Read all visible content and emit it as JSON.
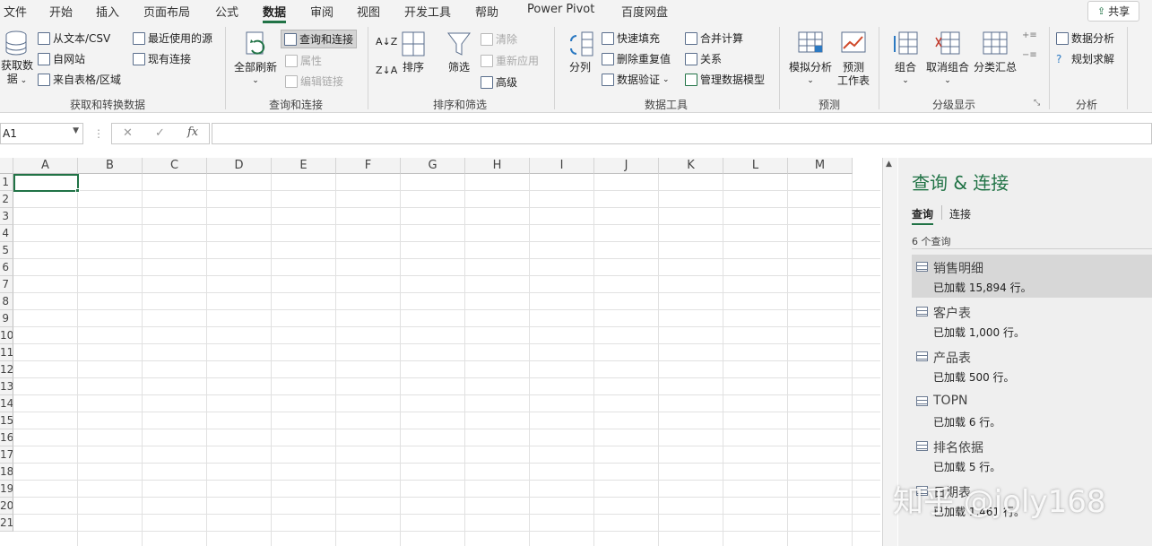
{
  "tabs": [
    {
      "label": "文件"
    },
    {
      "label": "开始"
    },
    {
      "label": "插入"
    },
    {
      "label": "页面布局"
    },
    {
      "label": "公式"
    },
    {
      "label": "数据"
    },
    {
      "label": "审阅"
    },
    {
      "label": "视图"
    },
    {
      "label": "开发工具"
    },
    {
      "label": "帮助"
    },
    {
      "label": "Power Pivot"
    },
    {
      "label": "百度网盘"
    }
  ],
  "active_tab": "数据",
  "share_label": "共享",
  "ribbon": {
    "get_transform": {
      "big_line1": "获取数",
      "big_line2": "据",
      "from_text": "从文本/CSV",
      "from_web": "自网站",
      "from_table": "来自表格/区域",
      "recent": "最近使用的源",
      "existing": "现有连接",
      "group": "获取和转换数据"
    },
    "queries": {
      "refresh": "全部刷新",
      "queries_conn": "查询和连接",
      "properties": "属性",
      "edit_links": "编辑链接",
      "group": "查询和连接"
    },
    "sort_filter": {
      "sort": "排序",
      "filter": "筛选",
      "clear": "清除",
      "reapply": "重新应用",
      "advanced": "高级",
      "group": "排序和筛选"
    },
    "data_tools": {
      "split": "分列",
      "flash": "快速填充",
      "dedup": "删除重复值",
      "validate": "数据验证",
      "consolidate": "合并计算",
      "relations": "关系",
      "model": "管理数据模型",
      "group": "数据工具"
    },
    "forecast": {
      "whatif": "模拟分析",
      "sheet_line1": "预测",
      "sheet_line2": "工作表",
      "group": "预测"
    },
    "outline": {
      "group_btn": "组合",
      "ungroup": "取消组合",
      "subtotal": "分类汇总",
      "group": "分级显示"
    },
    "analysis": {
      "data_analysis": "数据分析",
      "solver": "规划求解",
      "group": "分析"
    }
  },
  "formula_bar": {
    "cell_ref": "A1",
    "fx": "fx"
  },
  "columns": [
    "A",
    "B",
    "C",
    "D",
    "E",
    "F",
    "G",
    "H",
    "I",
    "J",
    "K",
    "L",
    "M"
  ],
  "rows": [
    "1",
    "2",
    "3",
    "4",
    "5",
    "6",
    "7",
    "8",
    "9",
    "10",
    "11",
    "12",
    "13",
    "14",
    "15",
    "16",
    "17",
    "18",
    "19",
    "20",
    "21"
  ],
  "pane": {
    "title": "查询 & 连接",
    "tab_queries": "查询",
    "tab_connections": "连接",
    "count": "6 个查询",
    "items": [
      {
        "name": "销售明细",
        "status": "已加载 15,894 行。"
      },
      {
        "name": "客户表",
        "status": "已加载 1,000 行。"
      },
      {
        "name": "产品表",
        "status": "已加载 500 行。"
      },
      {
        "name": "TOPN",
        "status": "已加载 6 行。"
      },
      {
        "name": "排名依据",
        "status": "已加载 5 行。"
      },
      {
        "name": "日期表",
        "status": "已加载 1,461 行。"
      }
    ]
  },
  "watermark": "知乎 @joly168",
  "colors": {
    "accent": "#217346"
  }
}
